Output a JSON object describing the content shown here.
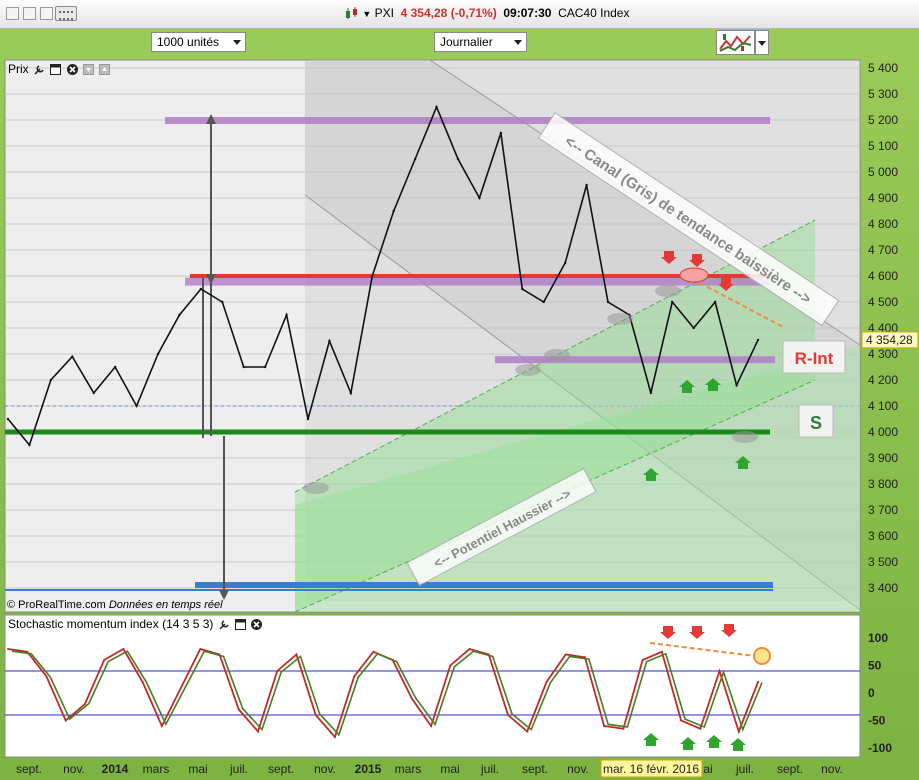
{
  "window": {
    "title_symbol": "PXI",
    "title_price": "4 354,28",
    "title_change": "(-0,71%)",
    "title_time": "09:07:30",
    "title_name": "CAC40 Index"
  },
  "toolbar": {
    "units_value": "1000 unités",
    "period_value": "Journalier"
  },
  "price_panel": {
    "label": "Prix",
    "copyright": "© ProRealTime.com",
    "realtime": "Données en temps réel",
    "last_price_label": "4 354,28",
    "annotation_canal": "<-- Canal (Gris) de tendance baissière -->",
    "annotation_potentiel": "<-- Potentiel Haussier -->",
    "badge_r_int": "R-Int",
    "badge_s": "S",
    "colors": {
      "resistance": "#e53935",
      "support": "#1b8a1b",
      "purple_zone": "#b07cc6",
      "blue_line": "#3a7bd5",
      "green_channel": "#7bd17b",
      "grey_channel": "#b0b0b0"
    }
  },
  "stoch_panel": {
    "label": "Stochastic momentum index (14 3 5 3)",
    "colors": {
      "line1": "#c62828",
      "line2": "#4a7d1f"
    }
  },
  "x_axis": {
    "ticks": [
      "sept.",
      "nov.",
      "2014",
      "mars",
      "mai",
      "juil.",
      "sept.",
      "nov.",
      "2015",
      "mars",
      "mai",
      "juil.",
      "sept.",
      "nov.",
      "ai",
      "juil.",
      "sept.",
      "nov."
    ],
    "bold_ticks": [
      "2014",
      "2015"
    ],
    "cursor_label": "mar. 16 févr. 2016"
  },
  "chart_data": [
    {
      "type": "line",
      "title": "Prix",
      "ylim": [
        3350,
        5420
      ],
      "y_ticks": [
        "5 400",
        "5 300",
        "5 200",
        "5 100",
        "5 000",
        "4 900",
        "4 800",
        "4 700",
        "4 600",
        "4 500",
        "4 400",
        "4 300",
        "4 200",
        "4 100",
        "4 000",
        "3 900",
        "3 800",
        "3 700",
        "3 600",
        "3 500",
        "3 400"
      ],
      "series": [
        {
          "x": [
            "2013-08",
            "2013-09",
            "2013-10",
            "2013-11",
            "2013-12",
            "2014-01",
            "2014-02",
            "2014-03",
            "2014-04",
            "2014-05",
            "2014-06",
            "2014-07",
            "2014-08",
            "2014-09",
            "2014-10",
            "2014-11",
            "2014-12",
            "2015-01",
            "2015-02",
            "2015-03",
            "2015-04",
            "2015-05",
            "2015-06",
            "2015-07",
            "2015-08",
            "2015-09",
            "2015-10",
            "2015-11",
            "2015-12",
            "2016-01",
            "2016-02",
            "2016-03",
            "2016-04",
            "2016-05",
            "2016-06",
            "2016-07"
          ],
          "values": [
            4050,
            3950,
            4200,
            4290,
            4150,
            4250,
            4100,
            4300,
            4450,
            4550,
            4500,
            4250,
            4250,
            4450,
            4050,
            4350,
            4150,
            4600,
            4850,
            5050,
            5250,
            5050,
            4900,
            5150,
            4550,
            4500,
            4650,
            4950,
            4500,
            4450,
            4150,
            4500,
            4400,
            4500,
            4180,
            4354
          ]
        }
      ],
      "levels": {
        "resistance": 4600,
        "support": 4000,
        "purple_top": 5200,
        "purple_mid": 4590,
        "purple_low": 4280,
        "blue_bottom": 3400
      }
    },
    {
      "type": "line",
      "title": "Stochastic momentum index (14 3 5 3)",
      "ylim": [
        -110,
        110
      ],
      "y_ticks": [
        "100",
        "50",
        "0",
        "-50",
        "-100"
      ],
      "reference_lines": [
        40,
        -40
      ],
      "series": [
        {
          "values": [
            80,
            75,
            30,
            -50,
            -20,
            60,
            80,
            20,
            -60,
            10,
            80,
            70,
            -30,
            -70,
            40,
            70,
            -40,
            -80,
            30,
            75,
            60,
            -10,
            -60,
            50,
            80,
            70,
            -40,
            -70,
            20,
            70,
            65,
            -60,
            -65,
            60,
            75,
            -50,
            -65,
            40,
            -70,
            20
          ]
        }
      ]
    }
  ]
}
